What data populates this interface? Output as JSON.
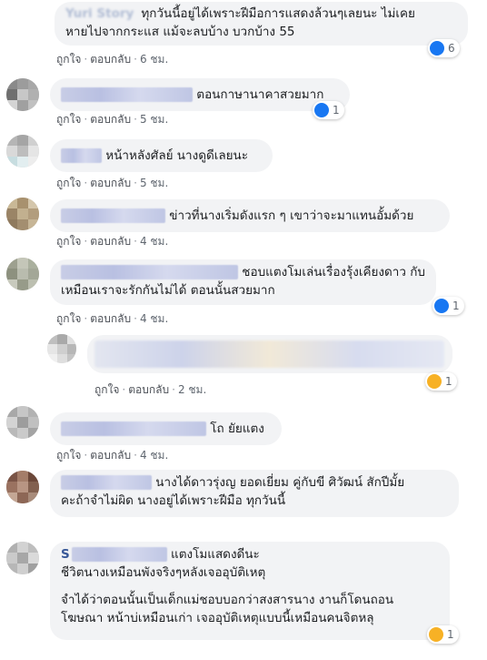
{
  "actions": {
    "like": "ถูกใจ",
    "reply": "ตอบกลับ",
    "separator": "·"
  },
  "colors": {
    "bubble": "#f2f3f5",
    "like_blue": "#1877f2",
    "meta_gray": "#606770"
  },
  "comments": [
    {
      "name_visible": "Yuri Story",
      "lines": [
        "ทุกวันนี้อยู่ได้เพราะฝีมือการแสดงล้วนๆเลยนะ ไม่เคย",
        "หายไปจากกระแส แม้จะลบบ้าง บวกบ้าง 55"
      ],
      "time": "6 ชม.",
      "reaction": {
        "icon": "like-icon",
        "count": "6"
      }
    },
    {
      "name_visible": "Phikanaya ...",
      "lines": [
        "ตอนกาษานาคาสวยมาก"
      ],
      "time": "5 ชม.",
      "reaction": {
        "icon": "like-icon",
        "count": "1"
      }
    },
    {
      "name_visible": "",
      "lines": [
        "หน้าหลังศัลย์ นางดูดีเลยนะ"
      ],
      "time": "5 ชม.",
      "reaction": null
    },
    {
      "name_visible": "",
      "lines": [
        "ข่าวที่นางเริ่มดังแรก ๆ เขาว่าจะมาแทนอั้มด้วย"
      ],
      "time": "4 ชม.",
      "reaction": null
    },
    {
      "name_visible": "",
      "lines": [
        "ชอบแตงโมเล่นเรื่องรุ้งเคียงดาว กับ",
        "เหมือนเราจะรักกันไม่ได้ ตอนนั้นสวยมาก"
      ],
      "time": "4 ชม.",
      "reaction": {
        "icon": "like-icon",
        "count": "1"
      }
    },
    {
      "name_visible": "",
      "lines": [],
      "time": "2 ชม.",
      "reaction": {
        "icon": "haha-icon",
        "count": "1"
      }
    },
    {
      "name_visible": "",
      "lines": [
        "โถ ยัยแตง"
      ],
      "time": "4 ชม.",
      "reaction": null
    },
    {
      "name_visible": "",
      "lines": [
        "นางได้ดาวรุ่งญ ยอดเยี่ยม คู่กับขี ศิวัฒน์ สักปีมั้ย",
        "คะถ้าจำไม่ผิด นางอยู่ได้เพราะฝีมือ ทุกวันนี้"
      ],
      "time": "",
      "reaction": null
    },
    {
      "name_visible": "S",
      "lines": [
        "แตงโมแสดงดีนะ",
        "ชีวิตนางเหมือนพังจริงๆหลังเจออุบัติเหตุ",
        "",
        "จำได้ว่าตอนนั้นเป็นเด็กแม่ชอบบอกว่าสงสารนาง งานก็โดนถอน",
        "โฆษณา หน้าบ่เหมือนเก่า เจออุบัติเหตุแบบนี้เหมือนคนจิตหลุ"
      ],
      "time": "",
      "reaction": {
        "icon": "sad-icon",
        "count": "1"
      }
    }
  ]
}
